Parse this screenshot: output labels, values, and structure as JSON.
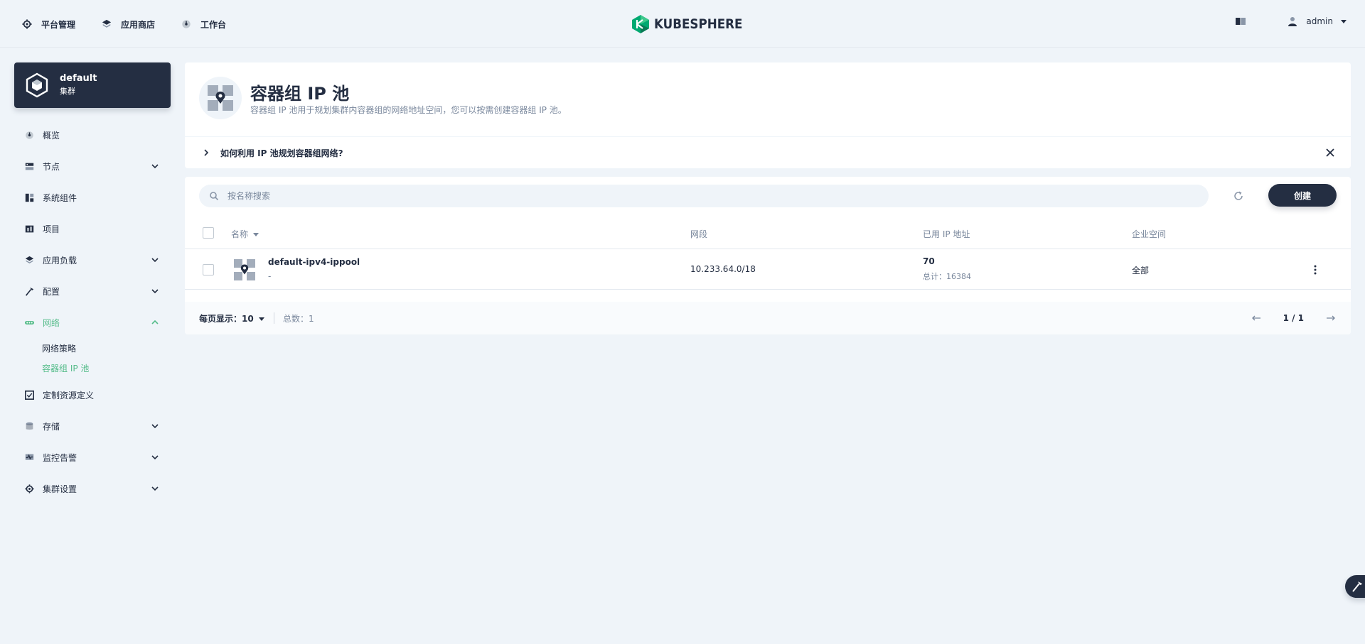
{
  "header": {
    "nav": [
      {
        "label": "平台管理",
        "icon": "gear-icon"
      },
      {
        "label": "应用商店",
        "icon": "appstore-icon"
      },
      {
        "label": "工作台",
        "icon": "dashboard-icon"
      }
    ],
    "logo_text": "KUBESPHERE",
    "user": "admin"
  },
  "cluster": {
    "name": "default",
    "type": "集群"
  },
  "sidebar": {
    "items": [
      {
        "label": "概览",
        "icon": "dashboard-icon"
      },
      {
        "label": "节点",
        "icon": "server-icon"
      },
      {
        "label": "系统组件",
        "icon": "components-icon"
      },
      {
        "label": "项目",
        "icon": "project-icon"
      },
      {
        "label": "应用负载",
        "icon": "layers-icon"
      },
      {
        "label": "配置",
        "icon": "hammer-icon"
      },
      {
        "label": "网络",
        "icon": "network-icon"
      },
      {
        "label": "定制资源定义",
        "icon": "crd-icon"
      },
      {
        "label": "存储",
        "icon": "database-icon"
      },
      {
        "label": "监控告警",
        "icon": "monitor-icon"
      },
      {
        "label": "集群设置",
        "icon": "gear-icon"
      }
    ],
    "network_sub": [
      "网络策略",
      "容器组 IP 池"
    ]
  },
  "page": {
    "title": "容器组 IP 池",
    "description": "容器组 IP 池用于规划集群内容器组的网络地址空间，您可以按需创建容器组 IP 池。",
    "tip": "如何利用 IP 池规划容器组网络?"
  },
  "toolbar": {
    "search_placeholder": "按名称搜索",
    "create_label": "创建"
  },
  "table": {
    "columns": [
      "名称",
      "网段",
      "已用 IP 地址",
      "企业空间"
    ],
    "rows": [
      {
        "name": "default-ipv4-ippool",
        "desc": "-",
        "cidr": "10.233.64.0/18",
        "used": "70",
        "total": "总计：16384",
        "workspace": "全部"
      }
    ]
  },
  "footer": {
    "per_page": "每页显示：10",
    "total": "总数：1",
    "page": "1 / 1"
  },
  "colors": {
    "accent": "#55bc8a",
    "dark": "#242e42",
    "muted": "#79879c",
    "background": "#eff4f9"
  }
}
